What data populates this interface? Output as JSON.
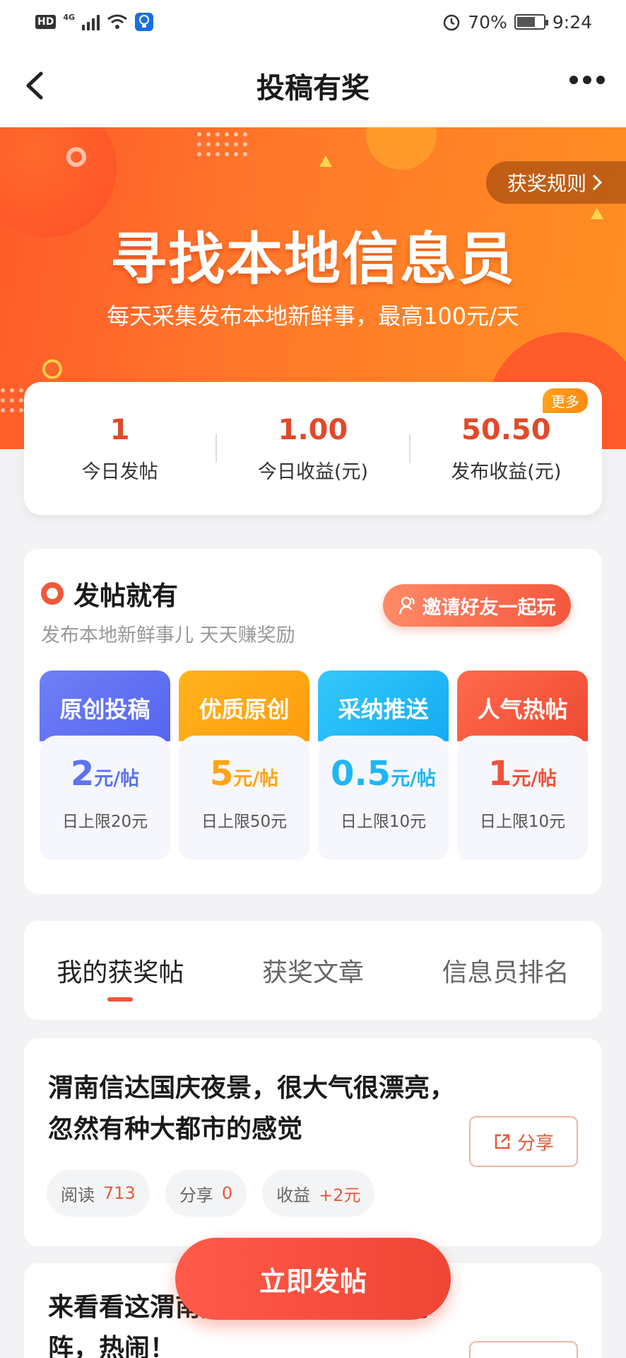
{
  "status_bar": {
    "hd": "HD",
    "network": "4G",
    "alarm_icon": "alarm-icon",
    "battery": "70%",
    "battery_level": 0.7,
    "time": "9:24"
  },
  "header": {
    "title": "投稿有奖",
    "back_icon": "chevron-left-icon",
    "more_icon": "more-dots-icon"
  },
  "banner": {
    "rules_label": "获奖规则",
    "title": "寻找本地信息员",
    "subtitle": "每天采集发布本地新鲜事，最高100元/天"
  },
  "stats": [
    {
      "value": "1",
      "label": "今日发帖"
    },
    {
      "value": "1.00",
      "label": "今日收益(元)"
    },
    {
      "value": "50.50",
      "label": "发布收益(元)",
      "badge": "更多"
    }
  ],
  "post_section": {
    "title": "发帖就有",
    "subtitle": "发布本地新鲜事儿 天天赚奖励",
    "invite_label": "邀请好友一起玩",
    "rewards": [
      {
        "name": "原创投稿",
        "amount": "2",
        "unit": "元/帖",
        "limit": "日上限20元",
        "color": "#5d73f0"
      },
      {
        "name": "优质原创",
        "amount": "5",
        "unit": "元/帖",
        "limit": "日上限50元",
        "color": "#ffa412"
      },
      {
        "name": "采纳推送",
        "amount": "0.5",
        "unit": "元/帖",
        "limit": "日上限10元",
        "color": "#1fb6f5"
      },
      {
        "name": "人气热帖",
        "amount": "1",
        "unit": "元/帖",
        "limit": "日上限10元",
        "color": "#f0523a"
      }
    ]
  },
  "tabs": [
    {
      "label": "我的获奖帖",
      "active": true
    },
    {
      "label": "获奖文章",
      "active": false
    },
    {
      "label": "信息员排名",
      "active": false
    }
  ],
  "articles": [
    {
      "title": "渭南信达国庆夜景，很大气很漂亮，忽然有种大都市的感觉",
      "share_label": "分享",
      "read_label": "阅读",
      "read_value": "713",
      "share_count_label": "分享",
      "share_count_value": "0",
      "income_label": "收益",
      "income_value": "+2元"
    },
    {
      "title": "来看看这渭南广场舞还有广场舞助阵，热闹！"
    }
  ],
  "fab_label": "立即发帖",
  "colors": {
    "accent": "#f0573a",
    "banner_start": "#ff5a2a",
    "banner_end": "#ff8f22"
  }
}
